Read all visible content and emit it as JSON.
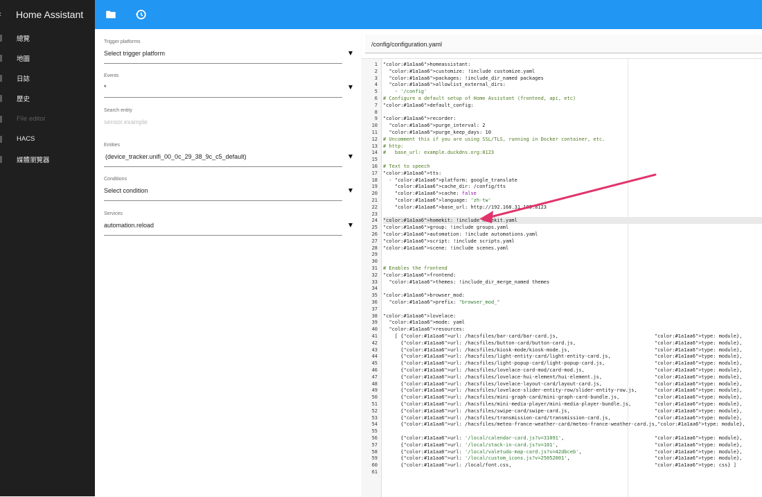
{
  "app": {
    "title": "Home Assistant"
  },
  "sidebar": {
    "items": [
      {
        "label": "總覽",
        "disabled": false
      },
      {
        "label": "地圖",
        "disabled": false
      },
      {
        "label": "日誌",
        "disabled": false
      },
      {
        "label": "歷史",
        "disabled": false
      },
      {
        "label": "File editor",
        "disabled": true
      },
      {
        "label": "HACS",
        "disabled": false
      },
      {
        "label": "媒體瀏覽器",
        "disabled": false
      }
    ]
  },
  "toolbar": {
    "icons": [
      "folder-icon",
      "history-icon"
    ]
  },
  "form": {
    "trigger_platforms": {
      "label": "Trigger platforms",
      "value": "Select trigger platform"
    },
    "events": {
      "label": "Events",
      "value": "*"
    },
    "search_entity": {
      "label": "Search entity",
      "placeholder": "sensor.example"
    },
    "entities": {
      "label": "Entities",
      "value": "(device_tracker.unifi_00_0c_29_38_9c_c5_default)"
    },
    "conditions": {
      "label": "Conditions",
      "value": "Select condition"
    },
    "services": {
      "label": "Services",
      "value": "automation.reload"
    }
  },
  "editor": {
    "file_path": "/config/configuration.yaml",
    "active_line": 24,
    "lines": [
      "homeassistant:",
      "  customize: !include customize.yaml",
      "  packages: !include_dir_named packages",
      "  allowlist_external_dirs:",
      "    - '/config'",
      "# Configure a default setup of Home Assistant (frontend, api, etc)",
      "default_config:",
      "",
      "recorder:",
      "  purge_interval: 2",
      "  purge_keep_days: 10",
      "# Uncomment this if you are using SSL/TLS, running in Docker container, etc.",
      "# http:",
      "#   base_url: example.duckdns.org:8123",
      "",
      "# Text to speech",
      "tts:",
      "  - platform: google_translate",
      "    cache_dir: /config/tts",
      "    cache: false",
      "    language: 'zh-tw'",
      "    base_url: http://192.168.31.185:8123",
      "",
      "homekit: !include homekit.yaml",
      "group: !include groups.yaml",
      "automation: !include automations.yaml",
      "script: !include scripts.yaml",
      "scene: !include scenes.yaml",
      "",
      "",
      "# Enables the frontend",
      "frontend:",
      "  themes: !include_dir_merge_named themes",
      "",
      "browser_mod:",
      "  prefix: \"browser_mod_\"",
      "",
      "lovelace:",
      "  mode: yaml",
      "  resources:",
      "    [ {url: /hacsfiles/bar-card/bar-card.js,                                 type: module},",
      "      {url: /hacsfiles/button-card/button-card.js,                           type: module},",
      "      {url: /hacsfiles/kiosk-mode/kiosk-mode.js,                             type: module},",
      "      {url: /hacsfiles/light-entity-card/light-entity-card.js,               type: module},",
      "      {url: /hacsfiles/light-popup-card/light-popup-card.js,                 type: module},",
      "      {url: /hacsfiles/lovelace-card-mod/card-mod.js,                        type: module},",
      "      {url: /hacsfiles/lovelace-hui-element/hui-element.js,                  type: module},",
      "      {url: /hacsfiles/lovelace-layout-card/layout-card.js,                  type: module},",
      "      {url: /hacsfiles/lovelace-slider-entity-row/slider-entity-row.js,      type: module},",
      "      {url: /hacsfiles/mini-graph-card/mini-graph-card-bundle.js,            type: module},",
      "      {url: /hacsfiles/mini-media-player/mini-media-player-bundle.js,        type: module},",
      "      {url: /hacsfiles/swipe-card/swipe-card.js,                             type: module},",
      "      {url: /hacsfiles/transmission-card/transmission-card.js,               type: module},",
      "      {url: /hacsfiles/meteo-france-weather-card/meteo-france-weather-card.js,type: module},",
      "",
      "      {url: '/local/calendar-card.js?v=31091',                               type: module},",
      "      {url: '/local/stack-in-card.js?v=101',                                 type: module},",
      "      {url: '/local/valetudo-map-card.js?v=42dbceb',                         type: module},",
      "      {url: '/local/custom_icons.js?v=25052001',                             type: module},",
      "      {url: /local/font.css,                                                 type: css} ]",
      ""
    ]
  },
  "colors": {
    "key": "#1a1aa6",
    "comment": "#4f7a1f",
    "string": "#2f7a2f",
    "literal": "#8a1aa0",
    "annotation_arrow": "#e2336b"
  }
}
